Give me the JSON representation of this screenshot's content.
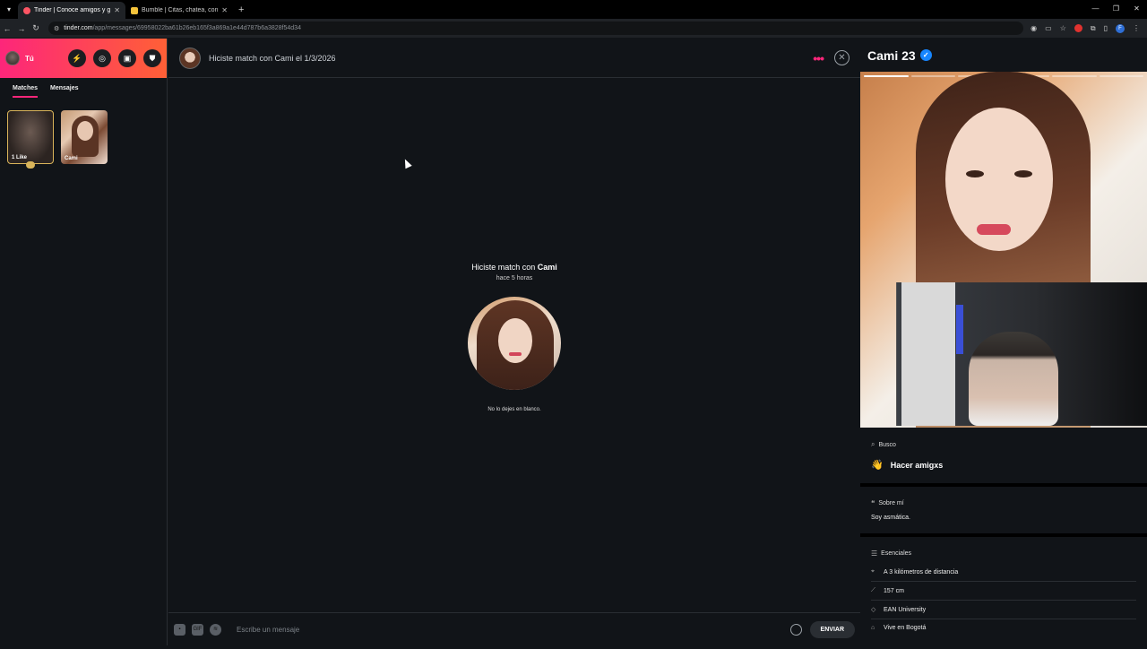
{
  "browser": {
    "tabs": [
      {
        "title": "Tinder | Conoce amigos y gente",
        "favicon_color": "#fd5564",
        "active": true
      },
      {
        "title": "Bumble | Citas, chatea, conoce",
        "favicon_color": "#f5c33b",
        "active": false
      }
    ],
    "url_host": "tinder.com",
    "url_path": "/app/messages/69958022ba61b26eb165f3a869a1e44d787b6a3828f54d34"
  },
  "sidebar": {
    "me_label": "Tú",
    "tabs": [
      {
        "label": "Matches",
        "active": true
      },
      {
        "label": "Mensajes",
        "active": false
      }
    ],
    "matches": [
      {
        "label": "1 Like",
        "type": "likes"
      },
      {
        "label": "Cami",
        "type": "profile"
      }
    ]
  },
  "chat": {
    "header_title": "Hiciste match con Cami el 1/3/2026",
    "match_text_prefix": "Hiciste match con",
    "match_name": "Cami",
    "match_ago": "hace 5 horas",
    "hint": "No lo dejes en blanco.",
    "input_placeholder": "Escribe un mensaje",
    "send_label": "ENVIAR"
  },
  "profile": {
    "name_age": "Cami 23",
    "photo_count": 6,
    "photo_active": 1,
    "looking_header": "Busco",
    "looking_value": "Hacer amigxs",
    "about_header": "Sobre mí",
    "about_text": "Soy asmática.",
    "essentials_header": "Esenciales",
    "essentials": [
      {
        "icon": "location-icon",
        "text": "A 3 kilómetros de distancia"
      },
      {
        "icon": "ruler-icon",
        "text": "157 cm"
      },
      {
        "icon": "school-icon",
        "text": "EAN University"
      },
      {
        "icon": "home-icon",
        "text": "Vive en Bogotá"
      }
    ]
  },
  "colors": {
    "brand_pink": "#fd267a",
    "brand_orange": "#ff6036",
    "verified_blue": "#1786ff"
  }
}
